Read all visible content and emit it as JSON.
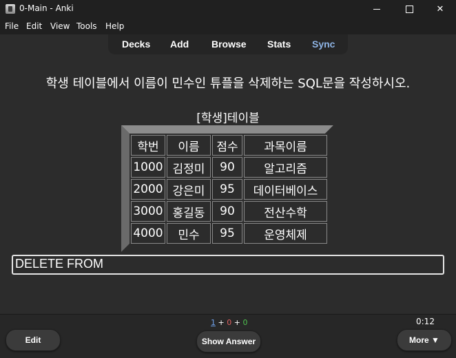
{
  "window": {
    "title": "0-Main - Anki",
    "controls": {
      "minimize": "",
      "maximize": "",
      "close": "✕"
    }
  },
  "menu": [
    "File",
    "Edit",
    "View",
    "Tools",
    "Help"
  ],
  "toolbar": [
    "Decks",
    "Add",
    "Browse",
    "Stats",
    "Sync"
  ],
  "card": {
    "question": "학생 테이블에서 이름이 민수인 튜플을 삭제하는 SQL문을 작성하시오.",
    "table_caption": "[학생]테이블",
    "table": {
      "headers": [
        "학번",
        "이름",
        "점수",
        "과목이름"
      ],
      "rows": [
        [
          "1000",
          "김정미",
          "90",
          "알고리즘"
        ],
        [
          "2000",
          "강은미",
          "95",
          "데이터베이스"
        ],
        [
          "3000",
          "홍길동",
          "90",
          "전산수학"
        ],
        [
          "4000",
          "민수",
          "95",
          "운영체제"
        ]
      ]
    },
    "answer_input": "DELETE FROM"
  },
  "status": {
    "new": "1",
    "plus1": " + ",
    "learn": "0",
    "plus2": " + ",
    "review": "0",
    "timer": "0:12"
  },
  "buttons": {
    "edit": "Edit",
    "show_answer": "Show Answer",
    "more": "More ▼"
  },
  "colors": {
    "background": "#2c2c2c",
    "sync": "#8fb5e6",
    "new": "#6ea0e8",
    "learn": "#e06060",
    "review": "#4fc24f"
  }
}
